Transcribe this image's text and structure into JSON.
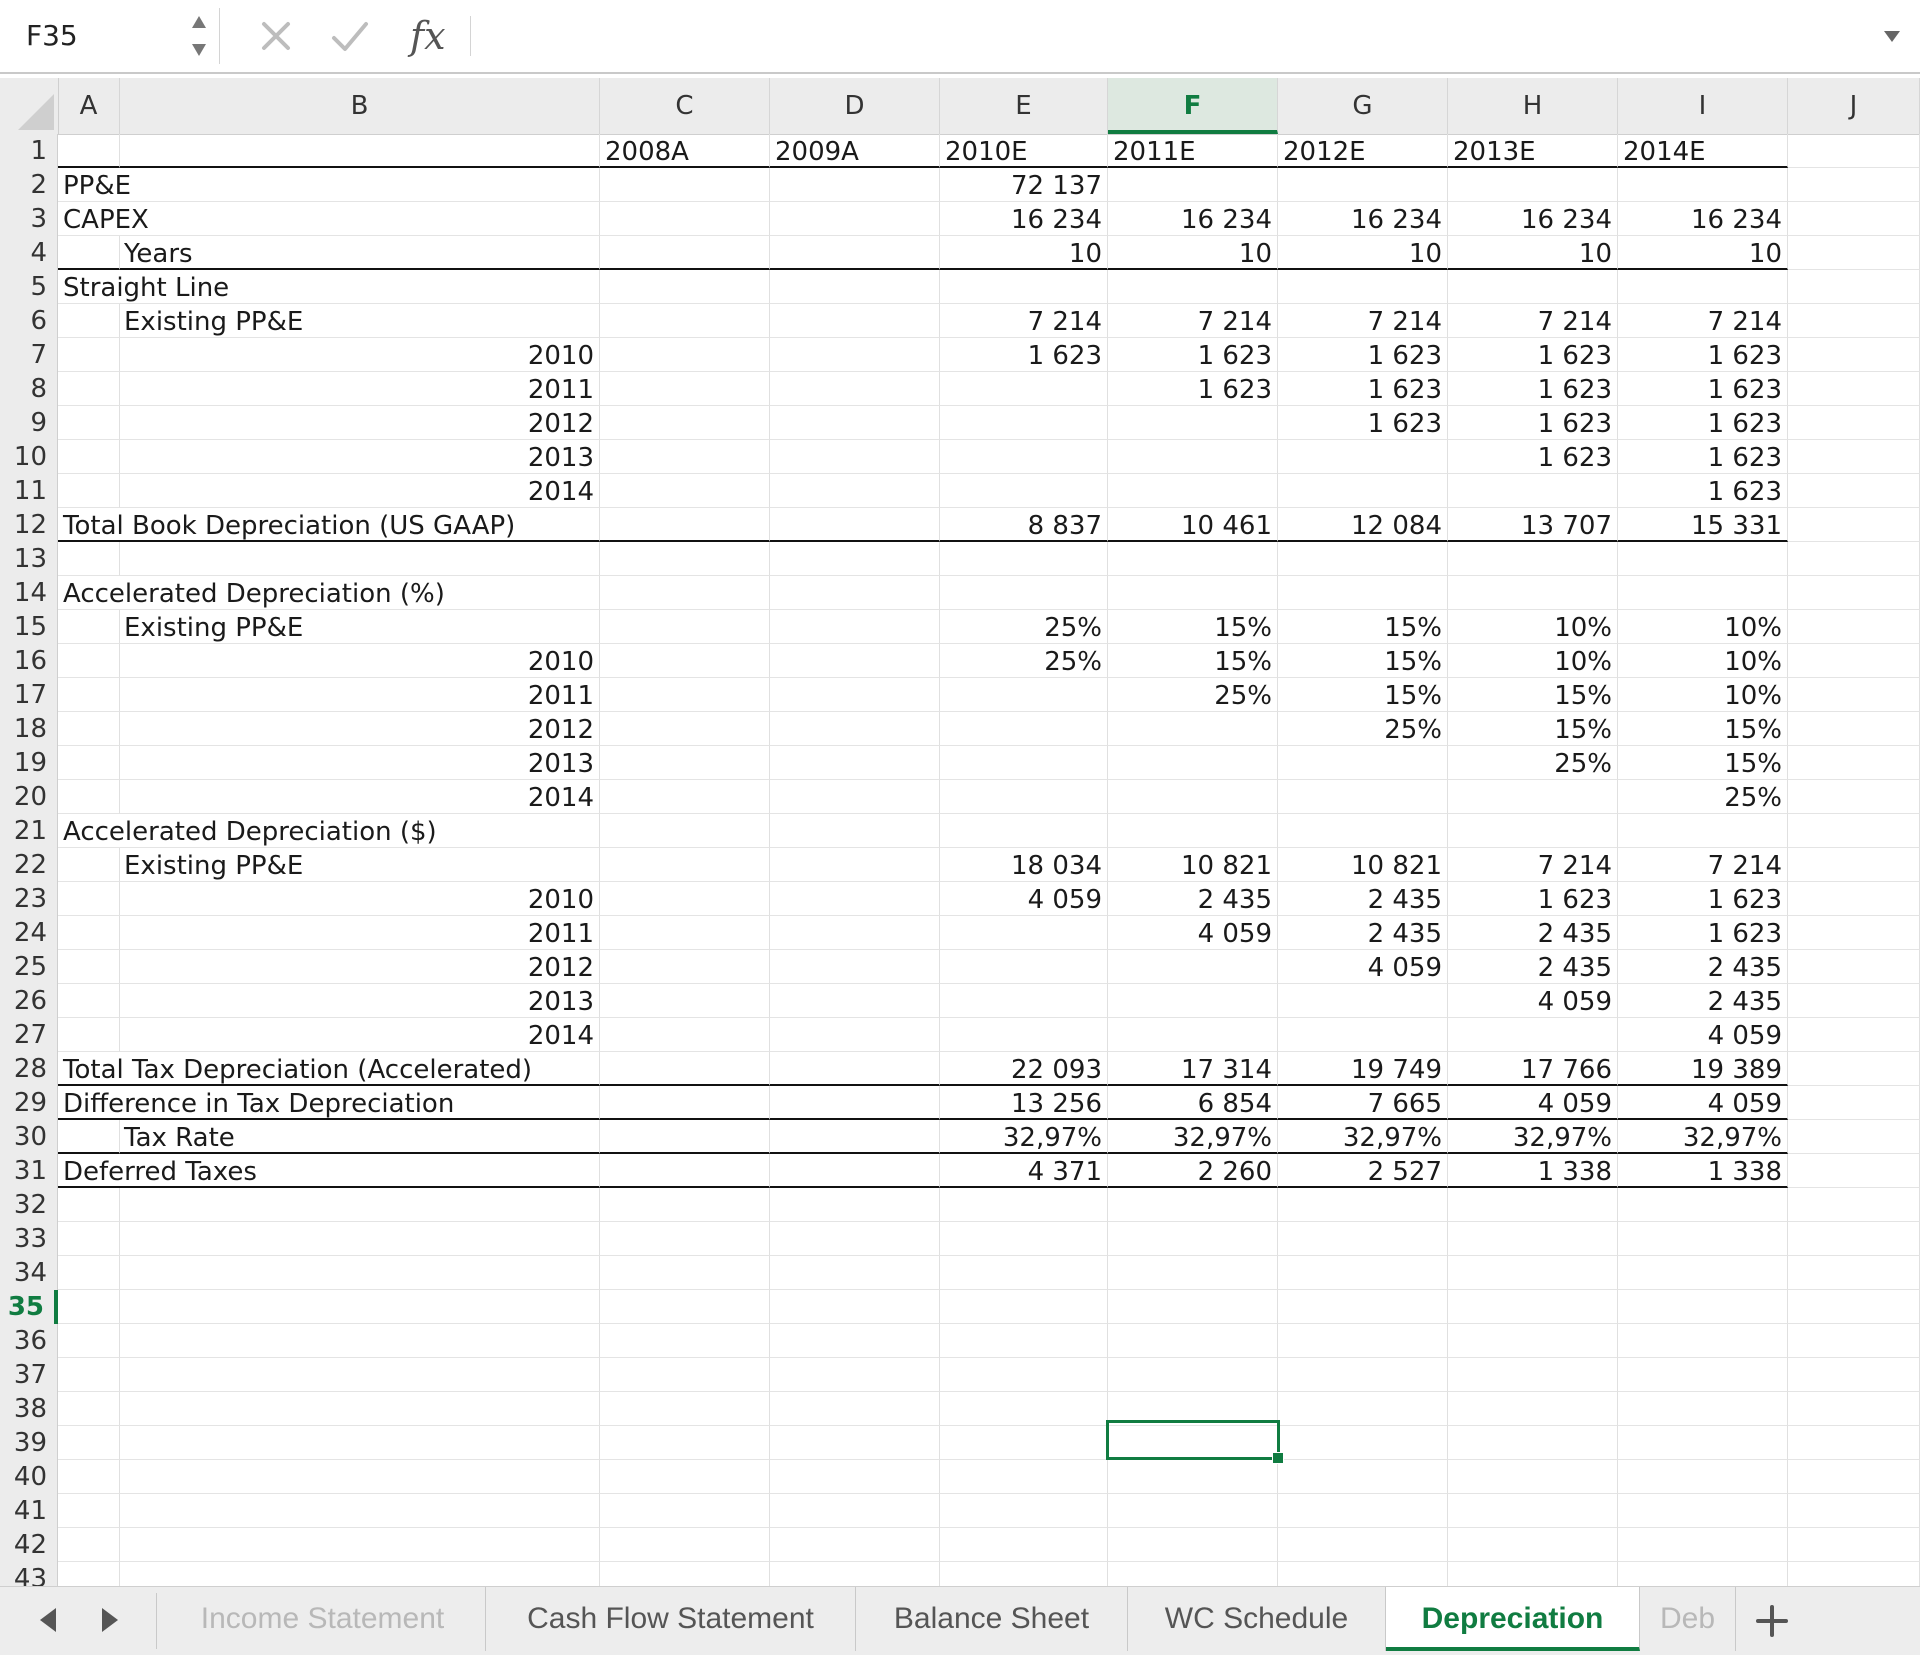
{
  "formula_bar": {
    "name_box": "F35",
    "fx_label": "fx",
    "formula_value": ""
  },
  "columns": [
    "A",
    "B",
    "C",
    "D",
    "E",
    "F",
    "G",
    "H",
    "I",
    "J"
  ],
  "active_column": "F",
  "rows": [
    {
      "n": "1",
      "B": "",
      "C": "2008A",
      "D": "2009A",
      "E": "2010E",
      "F": "2011E",
      "G": "2012E",
      "H": "2013E",
      "I": "2014E"
    },
    {
      "n": "2",
      "A": "PP&E",
      "E": "72 137"
    },
    {
      "n": "3",
      "A": "CAPEX",
      "E": "16 234",
      "F": "16 234",
      "G": "16 234",
      "H": "16 234",
      "I": "16 234"
    },
    {
      "n": "4",
      "B": "Years",
      "E": "10",
      "F": "10",
      "G": "10",
      "H": "10",
      "I": "10"
    },
    {
      "n": "5",
      "A": "Straight Line"
    },
    {
      "n": "6",
      "B": "Existing PP&E",
      "E": "7 214",
      "F": "7 214",
      "G": "7 214",
      "H": "7 214",
      "I": "7 214"
    },
    {
      "n": "7",
      "Byear": "2010",
      "E": "1 623",
      "F": "1 623",
      "G": "1 623",
      "H": "1 623",
      "I": "1 623"
    },
    {
      "n": "8",
      "Byear": "2011",
      "F": "1 623",
      "G": "1 623",
      "H": "1 623",
      "I": "1 623"
    },
    {
      "n": "9",
      "Byear": "2012",
      "G": "1 623",
      "H": "1 623",
      "I": "1 623"
    },
    {
      "n": "10",
      "Byear": "2013",
      "H": "1 623",
      "I": "1 623"
    },
    {
      "n": "11",
      "Byear": "2014",
      "I": "1 623"
    },
    {
      "n": "12",
      "A": "Total Book Depreciation (US GAAP)",
      "E": "8 837",
      "F": "10 461",
      "G": "12 084",
      "H": "13 707",
      "I": "15 331"
    },
    {
      "n": "13"
    },
    {
      "n": "14",
      "A": "Accelerated Depreciation (%)"
    },
    {
      "n": "15",
      "B": "Existing PP&E",
      "E": "25%",
      "F": "15%",
      "G": "15%",
      "H": "10%",
      "I": "10%"
    },
    {
      "n": "16",
      "Byear": "2010",
      "E": "25%",
      "F": "15%",
      "G": "15%",
      "H": "10%",
      "I": "10%"
    },
    {
      "n": "17",
      "Byear": "2011",
      "F": "25%",
      "G": "15%",
      "H": "15%",
      "I": "10%"
    },
    {
      "n": "18",
      "Byear": "2012",
      "G": "25%",
      "H": "15%",
      "I": "15%"
    },
    {
      "n": "19",
      "Byear": "2013",
      "H": "25%",
      "I": "15%"
    },
    {
      "n": "20",
      "Byear": "2014",
      "I": "25%"
    },
    {
      "n": "21",
      "A": "Accelerated Depreciation ($)"
    },
    {
      "n": "22",
      "B": "Existing PP&E",
      "E": "18 034",
      "F": "10 821",
      "G": "10 821",
      "H": "7 214",
      "I": "7 214"
    },
    {
      "n": "23",
      "Byear": "2010",
      "E": "4 059",
      "F": "2 435",
      "G": "2 435",
      "H": "1 623",
      "I": "1 623"
    },
    {
      "n": "24",
      "Byear": "2011",
      "F": "4 059",
      "G": "2 435",
      "H": "2 435",
      "I": "1 623"
    },
    {
      "n": "25",
      "Byear": "2012",
      "G": "4 059",
      "H": "2 435",
      "I": "2 435"
    },
    {
      "n": "26",
      "Byear": "2013",
      "H": "4 059",
      "I": "2 435"
    },
    {
      "n": "27",
      "Byear": "2014",
      "I": "4 059"
    },
    {
      "n": "28",
      "A": "Total Tax Depreciation (Accelerated)",
      "E": "22 093",
      "F": "17 314",
      "G": "19 749",
      "H": "17 766",
      "I": "19 389"
    },
    {
      "n": "29",
      "A": "Difference in Tax Depreciation",
      "E": "13 256",
      "F": "6 854",
      "G": "7 665",
      "H": "4 059",
      "I": "4 059"
    },
    {
      "n": "30",
      "B": "Tax Rate",
      "E": "32,97%",
      "F": "32,97%",
      "G": "32,97%",
      "H": "32,97%",
      "I": "32,97%"
    },
    {
      "n": "31",
      "A": "Deferred Taxes",
      "E": "4 371",
      "F": "2 260",
      "G": "2 527",
      "H": "1 338",
      "I": "1 338"
    },
    {
      "n": "32"
    },
    {
      "n": "33"
    },
    {
      "n": "34"
    },
    {
      "n": "35"
    },
    {
      "n": "36"
    },
    {
      "n": "37"
    },
    {
      "n": "38"
    },
    {
      "n": "39"
    },
    {
      "n": "40"
    },
    {
      "n": "41"
    },
    {
      "n": "42"
    },
    {
      "n": "43"
    }
  ],
  "active_row": "35",
  "sheet_tabs": [
    {
      "label": "Income Statement",
      "active": false
    },
    {
      "label": "Cash Flow Statement",
      "active": false
    },
    {
      "label": "Balance Sheet",
      "active": false
    },
    {
      "label": "WC Schedule",
      "active": false
    },
    {
      "label": "Depreciation",
      "active": true
    },
    {
      "label": "Deb",
      "active": false
    }
  ],
  "accent_color": "#107c41"
}
